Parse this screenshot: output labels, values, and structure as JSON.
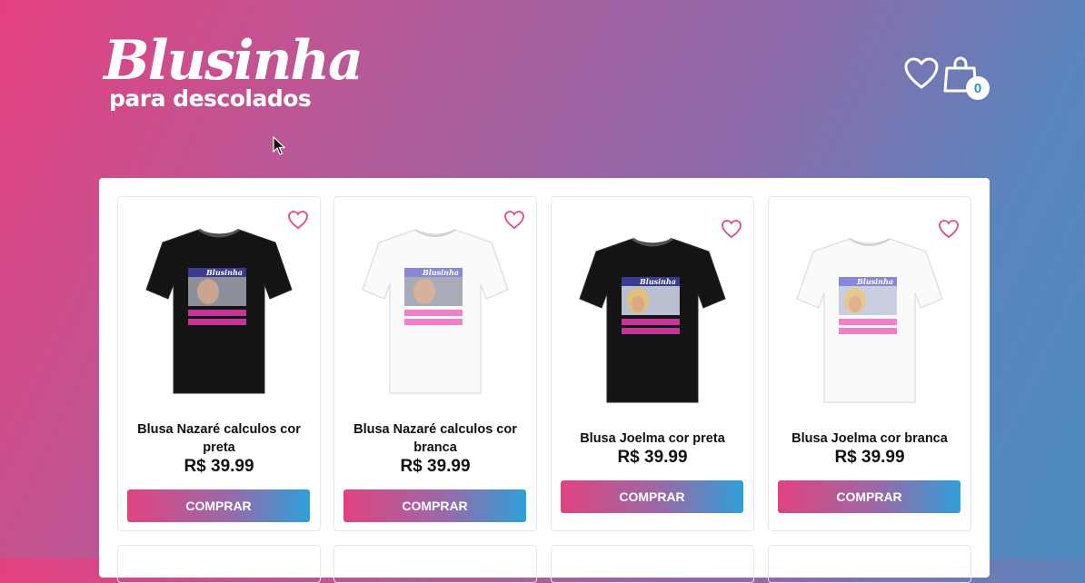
{
  "brand": {
    "name": "Blusinha",
    "tagline": "para descolados"
  },
  "header": {
    "cart_count": "0",
    "favorites_icon": "heart-outline-icon",
    "cart_icon": "shopping-bag-icon"
  },
  "colors": {
    "gradient_start": "#e5407f",
    "gradient_end": "#4c8bc0",
    "heart": "#e04a82",
    "badge_text": "#2f8fd0"
  },
  "products": [
    {
      "title": "Blusa Nazaré calculos cor preta",
      "price": "R$ 39.99",
      "button": "COMPRAR",
      "shirt_color": "black",
      "art": "nazare"
    },
    {
      "title": "Blusa Nazaré calculos cor branca",
      "price": "R$ 39.99",
      "button": "COMPRAR",
      "shirt_color": "white",
      "art": "nazare"
    },
    {
      "title": "Blusa Joelma cor preta",
      "price": "R$ 39.99",
      "button": "COMPRAR",
      "shirt_color": "black",
      "art": "joelma"
    },
    {
      "title": "Blusa Joelma cor branca",
      "price": "R$ 39.99",
      "button": "COMPRAR",
      "shirt_color": "white",
      "art": "joelma"
    }
  ],
  "print_label": "Blusinha"
}
